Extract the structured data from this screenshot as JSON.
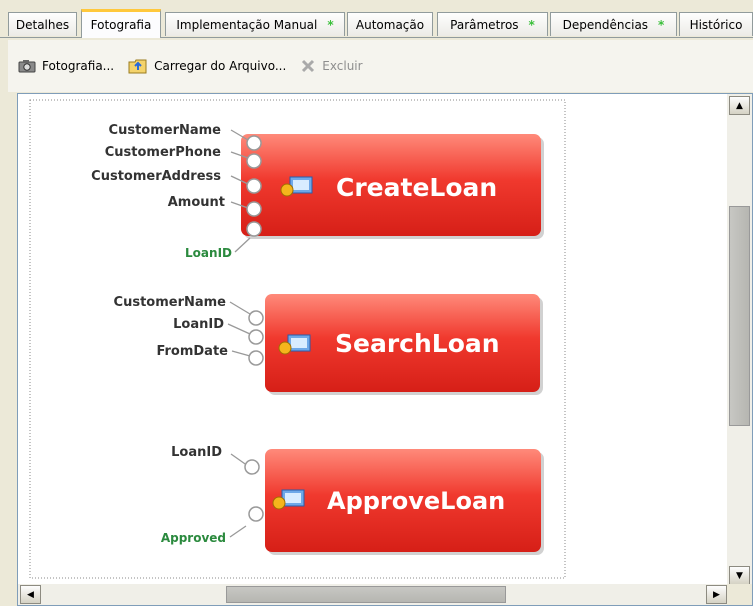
{
  "tabs": [
    {
      "label": "Detalhes",
      "modified": false,
      "active": false
    },
    {
      "label": "Fotografia",
      "modified": false,
      "active": true
    },
    {
      "label": "Implementação Manual",
      "modified": true,
      "active": false
    },
    {
      "label": "Automação",
      "modified": false,
      "active": false
    },
    {
      "label": "Parâmetros",
      "modified": true,
      "active": false
    },
    {
      "label": "Dependências",
      "modified": true,
      "active": false
    },
    {
      "label": "Histórico",
      "modified": false,
      "active": false
    }
  ],
  "modified_marker": "*",
  "toolbar": {
    "snapshot_label": "Fotografia...",
    "load_label": "Carregar do Arquivo...",
    "delete_label": "Excluir"
  },
  "components": [
    {
      "name": "CreateLoan",
      "inputs": [
        "CustomerName",
        "CustomerPhone",
        "CustomerAddress",
        "Amount"
      ],
      "outputs": [
        "LoanID"
      ]
    },
    {
      "name": "SearchLoan",
      "inputs": [
        "CustomerName",
        "LoanID",
        "FromDate"
      ],
      "outputs": []
    },
    {
      "name": "ApproveLoan",
      "inputs": [
        "LoanID"
      ],
      "outputs": [
        "Approved"
      ]
    }
  ],
  "colors": {
    "component_red": "#ea3128",
    "output_label": "#2b8a3e",
    "input_label": "#333333",
    "tab_active_accent": "#ffc83c"
  }
}
